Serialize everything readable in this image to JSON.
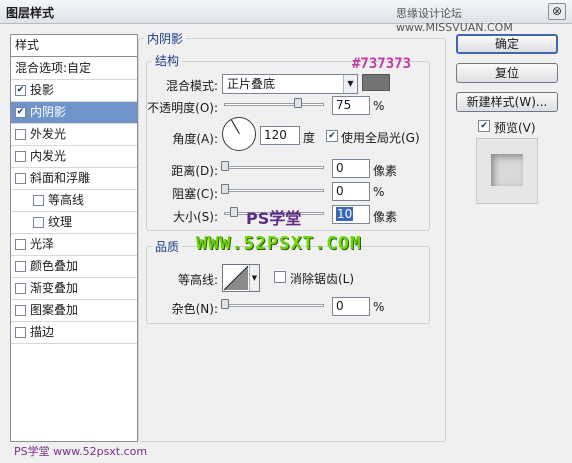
{
  "titlebar": {
    "title": "图层样式",
    "watermark": "思缘设计论坛 www.MISSVUAN.COM",
    "close_glyph": "⊗"
  },
  "sidebar": {
    "header": "样式",
    "blend_options": "混合选项:自定",
    "items": [
      {
        "label": "投影",
        "checked": true,
        "indent": false
      },
      {
        "label": "内阴影",
        "checked": true,
        "indent": false,
        "selected": true
      },
      {
        "label": "外发光",
        "checked": false,
        "indent": false
      },
      {
        "label": "内发光",
        "checked": false,
        "indent": false
      },
      {
        "label": "斜面和浮雕",
        "checked": false,
        "indent": false
      },
      {
        "label": "等高线",
        "checked": false,
        "indent": true
      },
      {
        "label": "纹理",
        "checked": false,
        "indent": true
      },
      {
        "label": "光泽",
        "checked": false,
        "indent": false
      },
      {
        "label": "颜色叠加",
        "checked": false,
        "indent": false
      },
      {
        "label": "渐变叠加",
        "checked": false,
        "indent": false
      },
      {
        "label": "图案叠加",
        "checked": false,
        "indent": false
      },
      {
        "label": "描边",
        "checked": false,
        "indent": false
      }
    ]
  },
  "inner_shadow": {
    "section_title": "内阴影",
    "structure": {
      "legend": "结构",
      "blend_mode_label": "混合模式:",
      "blend_mode_value": "正片叠底",
      "swatch_color": "#737373",
      "opacity_label": "不透明度(O):",
      "opacity_value": "75",
      "opacity_unit": "%",
      "angle_label": "角度(A):",
      "angle_value": "120",
      "angle_unit": "度",
      "global_light_label": "使用全局光(G)",
      "global_light_checked": true,
      "distance_label": "距离(D):",
      "distance_value": "0",
      "distance_unit": "像素",
      "choke_label": "阻塞(C):",
      "choke_value": "0",
      "choke_unit": "%",
      "size_label": "大小(S):",
      "size_value": "10",
      "size_unit": "像素"
    },
    "quality": {
      "legend": "品质",
      "contour_label": "等高线:",
      "anti_alias_label": "消除锯齿(L)",
      "anti_alias_checked": false,
      "noise_label": "杂色(N):",
      "noise_value": "0",
      "noise_unit": "%"
    }
  },
  "right_panel": {
    "ok_label": "确定",
    "reset_label": "复位",
    "new_style_label": "新建样式(W)...",
    "preview_label": "预览(V)",
    "preview_checked": true
  },
  "annotations": {
    "hex": "#737373",
    "ps_text": "PS学堂",
    "url_text": "WWW.52PSXT.COM",
    "bottom_text": "PS学堂 www.52psxt.com"
  },
  "colors": {
    "selected_bg": "#6f94c9",
    "legend_text": "#1b3d8a",
    "swatch": "#737373"
  }
}
